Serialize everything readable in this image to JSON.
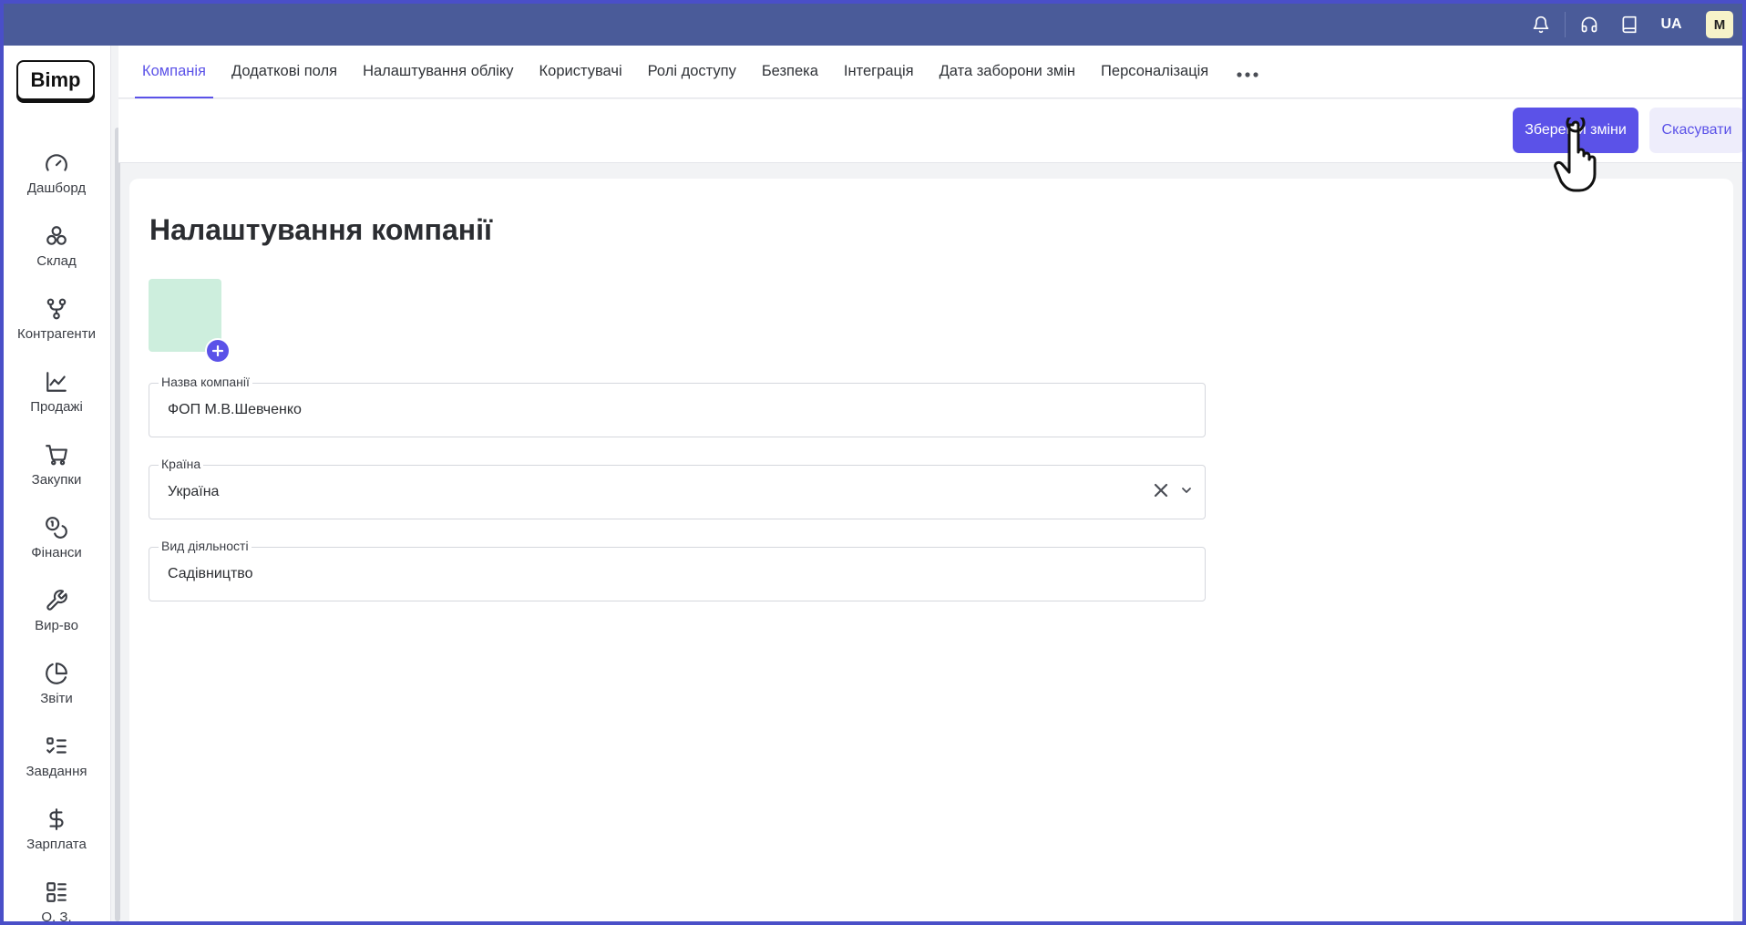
{
  "topbar": {
    "lang": "UA",
    "avatar_initial": "M",
    "icons": [
      "bell-icon",
      "headset-icon",
      "book-icon"
    ]
  },
  "sidebar": {
    "logo": "Bimp",
    "items": [
      {
        "label": "Дашборд",
        "icon": "gauge-icon"
      },
      {
        "label": "Склад",
        "icon": "boxes-icon"
      },
      {
        "label": "Контрагенти",
        "icon": "network-icon"
      },
      {
        "label": "Продажі",
        "icon": "line-chart-icon"
      },
      {
        "label": "Закупки",
        "icon": "cart-icon"
      },
      {
        "label": "Фінанси",
        "icon": "coins-icon"
      },
      {
        "label": "Вир-во",
        "icon": "wrench-icon"
      },
      {
        "label": "Звіти",
        "icon": "pie-chart-icon"
      },
      {
        "label": "Завдання",
        "icon": "checklist-icon"
      },
      {
        "label": "Зарплата",
        "icon": "dollar-icon"
      },
      {
        "label": "О. З.",
        "icon": "grid-list-icon"
      }
    ]
  },
  "tabs": [
    {
      "label": "Компанія",
      "active": true
    },
    {
      "label": "Додаткові поля"
    },
    {
      "label": "Налаштування обліку"
    },
    {
      "label": "Користувачі"
    },
    {
      "label": "Ролі доступу"
    },
    {
      "label": "Безпека"
    },
    {
      "label": "Інтеграція"
    },
    {
      "label": "Дата заборони змін"
    },
    {
      "label": "Персоналізація"
    }
  ],
  "actions": {
    "save": "Зберегти зміни",
    "cancel": "Скасувати"
  },
  "page": {
    "title": "Налаштування компанії",
    "fields": {
      "company_name": {
        "label": "Назва компанії",
        "value": "ФОП М.В.Шевченко"
      },
      "country": {
        "label": "Країна",
        "value": "Україна"
      },
      "activity": {
        "label": "Вид діяльності",
        "value": "Садівництво"
      }
    }
  },
  "colors": {
    "accent": "#5b52e8",
    "topbar": "#4a5b99",
    "logo_placeholder": "#cdeedd"
  }
}
